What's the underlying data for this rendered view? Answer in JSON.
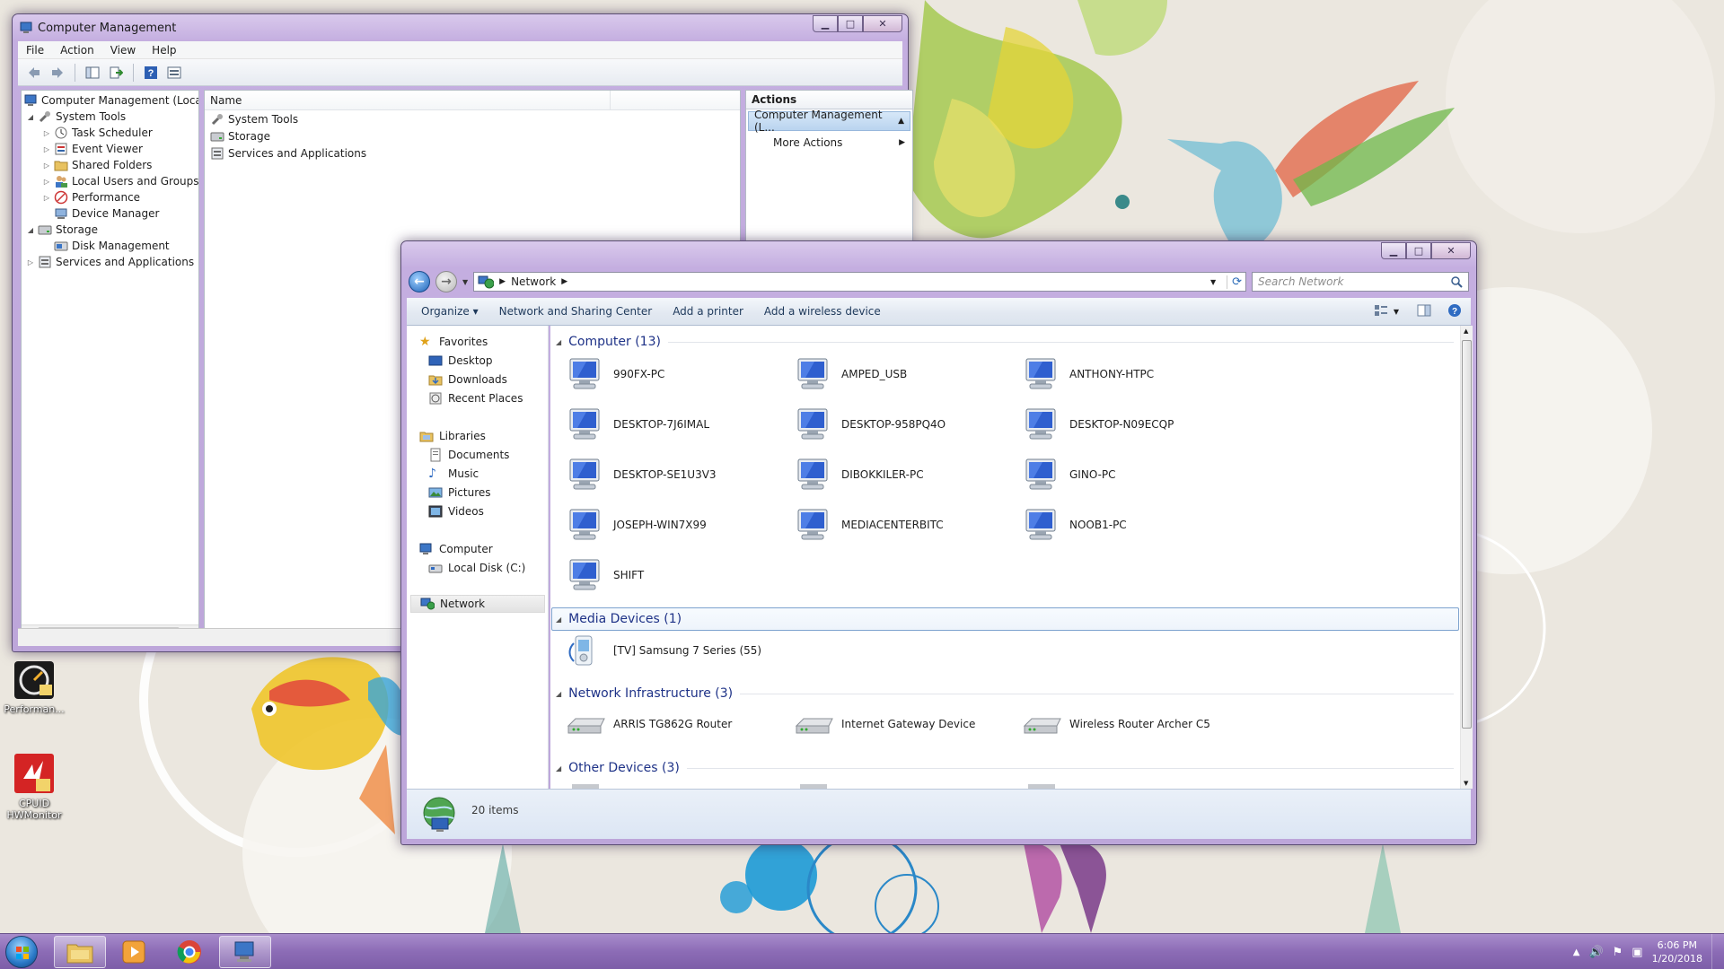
{
  "computer_management": {
    "title": "Computer Management",
    "menu": [
      "File",
      "Action",
      "View",
      "Help"
    ],
    "tree": [
      {
        "label": "Computer Management (Local",
        "level": 0,
        "expander": ""
      },
      {
        "label": "System Tools",
        "level": 1,
        "expander": "◢"
      },
      {
        "label": "Task Scheduler",
        "level": 2,
        "expander": "▷"
      },
      {
        "label": "Event Viewer",
        "level": 2,
        "expander": "▷"
      },
      {
        "label": "Shared Folders",
        "level": 2,
        "expander": "▷"
      },
      {
        "label": "Local Users and Groups",
        "level": 2,
        "expander": "▷"
      },
      {
        "label": "Performance",
        "level": 2,
        "expander": "▷"
      },
      {
        "label": "Device Manager",
        "level": 2,
        "expander": ""
      },
      {
        "label": "Storage",
        "level": 1,
        "expander": "◢"
      },
      {
        "label": "Disk Management",
        "level": 2,
        "expander": ""
      },
      {
        "label": "Services and Applications",
        "level": 1,
        "expander": "▷"
      }
    ],
    "list_header": "Name",
    "list_rows": [
      "System Tools",
      "Storage",
      "Services and Applications"
    ],
    "actions_header": "Actions",
    "actions_selected": "Computer Management (L...",
    "actions_item": "More Actions"
  },
  "network": {
    "breadcrumb": "Network",
    "search_placeholder": "Search Network",
    "commands": [
      "Organize ▾",
      "Network and Sharing Center",
      "Add a printer",
      "Add a wireless device"
    ],
    "nav": {
      "favorites": "Favorites",
      "favorites_items": [
        "Desktop",
        "Downloads",
        "Recent Places"
      ],
      "libraries": "Libraries",
      "libraries_items": [
        "Documents",
        "Music",
        "Pictures",
        "Videos"
      ],
      "computer": "Computer",
      "computer_items": [
        "Local Disk (C:)"
      ],
      "network": "Network"
    },
    "groups": {
      "computer": {
        "title": "Computer (13)",
        "items": [
          "990FX-PC",
          "AMPED_USB",
          "ANTHONY-HTPC",
          "DESKTOP-7J6IMAL",
          "DESKTOP-958PQ4O",
          "DESKTOP-N09ECQP",
          "DESKTOP-SE1U3V3",
          "DIBOKKILER-PC",
          "GINO-PC",
          "JOSEPH-WIN7X99",
          "MEDIACENTERBITC",
          "NOOB1-PC",
          "SHIFT"
        ]
      },
      "media": {
        "title": "Media Devices (1)",
        "items": [
          "[TV] Samsung 7 Series (55)"
        ]
      },
      "infrastructure": {
        "title": "Network Infrastructure (3)",
        "items": [
          "ARRIS TG862G Router",
          "Internet Gateway Device",
          "Wireless Router Archer C5"
        ]
      },
      "other": {
        "title": "Other Devices (3)"
      }
    },
    "status": "20 items"
  },
  "desktop_icons": [
    {
      "label": "Performan...",
      "icon": "performance-monitor-icon"
    },
    {
      "label": "CPUID HWMonitor",
      "icon": "hwmonitor-icon"
    }
  ],
  "taskbar": {
    "items": [
      "explorer-icon",
      "media-player-icon",
      "chrome-icon",
      "computer-management-icon"
    ],
    "time": "6:06 PM",
    "date": "1/20/2018"
  }
}
